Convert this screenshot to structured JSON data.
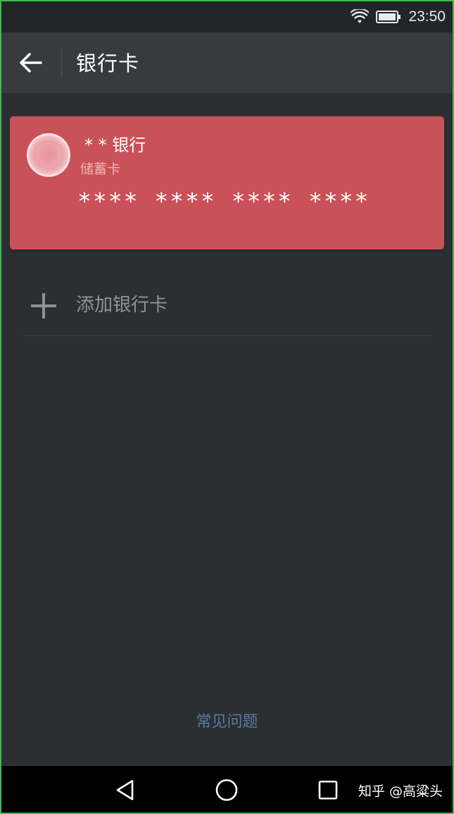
{
  "status_bar": {
    "time": "23:50",
    "icons": [
      "wifi-icon",
      "battery-icon"
    ]
  },
  "app_bar": {
    "back_icon": "arrow-left-icon",
    "title": "银行卡"
  },
  "card": {
    "bank_name": "* * 银行",
    "card_type": "储蓄卡",
    "card_number": "**** **** **** ****",
    "color": "#c95158"
  },
  "add_card": {
    "icon": "plus-icon",
    "label": "添加银行卡"
  },
  "faq": {
    "label": "常见问题",
    "color": "#5a79a8"
  },
  "nav_bar": {
    "buttons": [
      "back-triangle-icon",
      "home-circle-icon",
      "recents-square-icon"
    ],
    "watermark": "知乎 @高粱头"
  }
}
